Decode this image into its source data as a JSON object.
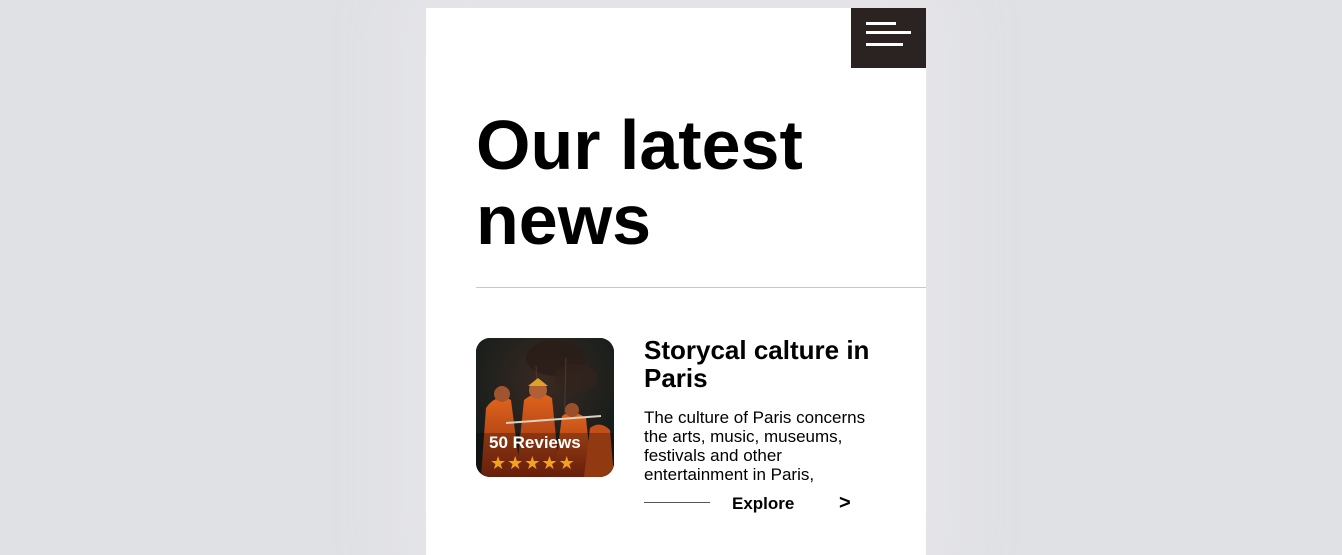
{
  "header": {
    "menu_icon": "hamburger-menu-icon"
  },
  "section": {
    "heading": "Our latest news"
  },
  "article": {
    "image_description_icon": "monks-with-umbrellas-photo",
    "reviews_label": "50 Reviews",
    "rating": 5,
    "rating_max": 5,
    "star_glyph": "★",
    "star_color": "#f4a21c",
    "title": "Storycal calture in Paris",
    "description": "The culture of Paris concerns the arts, music, museums, festivals and other entertainment in Paris,",
    "explore_label": "Explore",
    "explore_arrow": ">"
  },
  "colors": {
    "background": "#e0e1e5",
    "card": "#ffffff",
    "menu_button": "#2b2322",
    "text": "#000000"
  }
}
